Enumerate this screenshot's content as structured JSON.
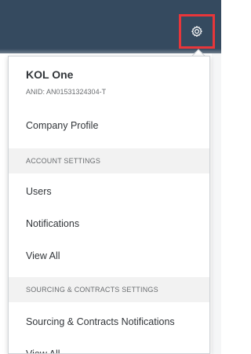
{
  "header": {
    "settings_icon": "gear-icon"
  },
  "account": {
    "name": "KOL One",
    "anid": "ANID: AN01531324304-T"
  },
  "menu": {
    "company_profile": "Company Profile",
    "account_settings_header": "ACCOUNT SETTINGS",
    "users": "Users",
    "notifications": "Notifications",
    "view_all_account": "View All",
    "sourcing_header": "SOURCING & CONTRACTS SETTINGS",
    "sourcing_notifications": "Sourcing & Contracts Notifications",
    "view_all_sourcing": "View All"
  },
  "colors": {
    "header_bg": "#354a5f",
    "highlight": "#e8363a",
    "section_bg": "#f2f2f2"
  }
}
